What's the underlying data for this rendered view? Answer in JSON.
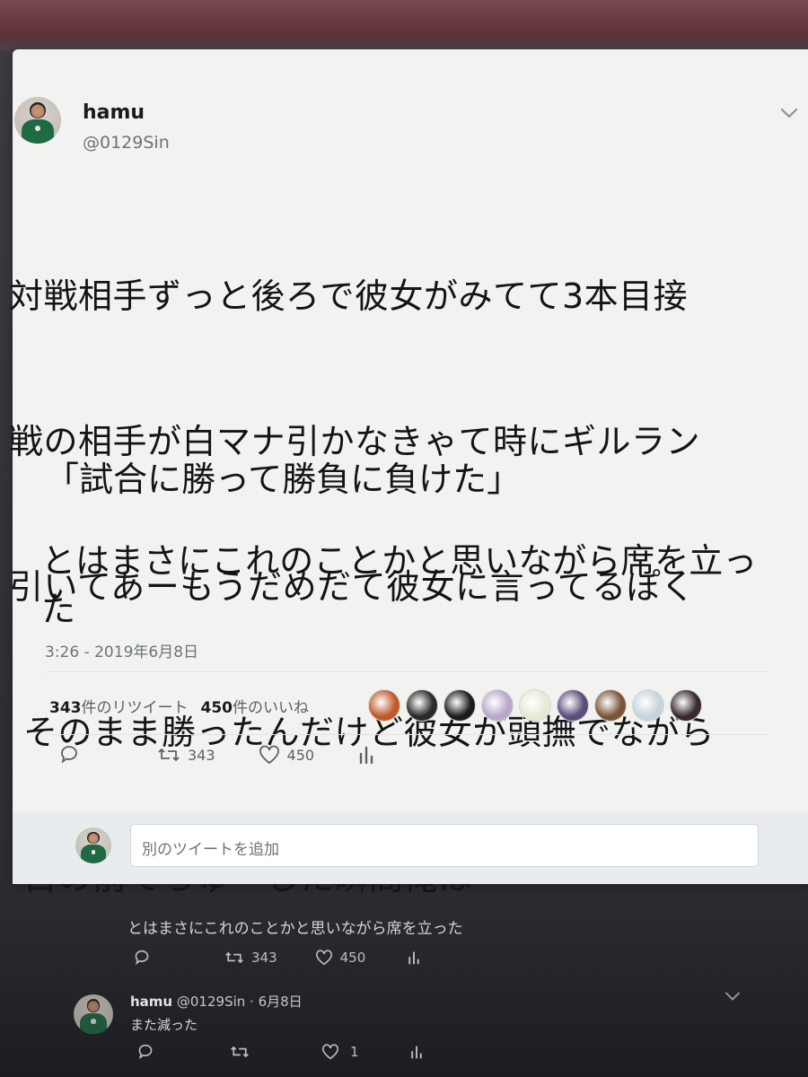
{
  "tweet": {
    "author_name": "hamu",
    "author_handle": "@0129Sin",
    "text_lines": [
      "対戦相手ずっと後ろで彼女がみてて3本目接",
      "戦の相手が白マナ引かなきゃて時にギルラン",
      "引いてあーもうだめだて彼女に言ってるぽく",
      "そのまま勝ったんだけど彼女が頭撫でながら",
      "目の前でちゅーした瞬間俺は"
    ],
    "quote": "「試合に勝って勝負に負けた」",
    "tail": "とはまさにこれのことかと思いながら席を立った",
    "timestamp": "3:26 - 2019年6月8日",
    "retweet_count": "343",
    "retweet_label": "件のリツイート",
    "like_count": "450",
    "like_label": "件のいいね",
    "action_retweets": "343",
    "action_likes": "450"
  },
  "reply_box": {
    "placeholder": "別のツイートを追加"
  },
  "thread_below": {
    "reply_text": "とはまさにこれのことかと思いながら席を立った",
    "retweets": "343",
    "likes": "450",
    "next_author_name": "hamu",
    "next_author_handle": "@0129Sin",
    "next_date": "· 6月8日",
    "next_text": "また減った",
    "next_likes": "1"
  },
  "colors": {
    "card_bg": "#f2f3f1",
    "text_primary": "#141414",
    "text_secondary": "#6b7379",
    "avatar_jacket": "#1f6a45"
  },
  "liker_avatar_colors": [
    "#c05a2a",
    "#2a2a2a",
    "#1c1c1c",
    "#b9a7c9",
    "#e8e8d8",
    "#5c4e7a",
    "#7a5436",
    "#c8d4dc",
    "#3a2a2e"
  ]
}
